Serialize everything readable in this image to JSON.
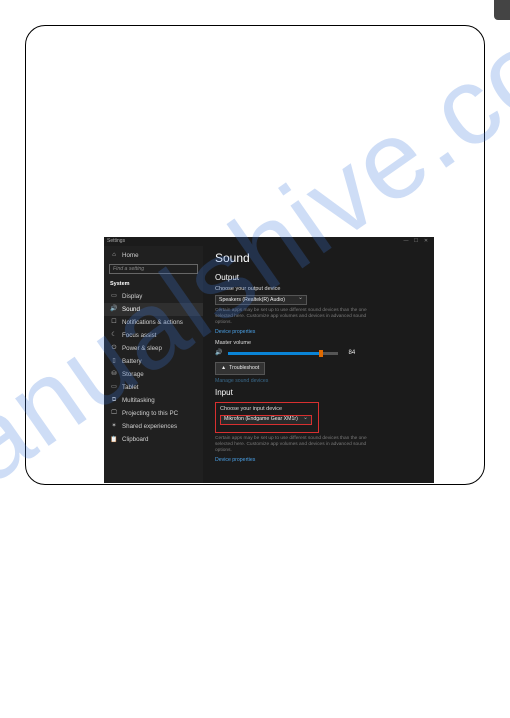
{
  "watermark": "manualshive.com",
  "window": {
    "title": "Settings",
    "controls": {
      "min": "—",
      "max": "☐",
      "close": "✕"
    }
  },
  "sidebar": {
    "home": "Home",
    "search_placeholder": "Find a setting",
    "section": "System",
    "items": [
      {
        "icon": "▭",
        "label": "Display"
      },
      {
        "icon": "🔊",
        "label": "Sound",
        "selected": true
      },
      {
        "icon": "☐",
        "label": "Notifications & actions"
      },
      {
        "icon": "☾",
        "label": "Focus assist"
      },
      {
        "icon": "⏻",
        "label": "Power & sleep"
      },
      {
        "icon": "▯",
        "label": "Battery"
      },
      {
        "icon": "⛁",
        "label": "Storage"
      },
      {
        "icon": "▭",
        "label": "Tablet"
      },
      {
        "icon": "⧉",
        "label": "Multitasking"
      },
      {
        "icon": "🖵",
        "label": "Projecting to this PC"
      },
      {
        "icon": "✶",
        "label": "Shared experiences"
      },
      {
        "icon": "📋",
        "label": "Clipboard"
      }
    ]
  },
  "page": {
    "title": "Sound",
    "output": {
      "heading": "Output",
      "choose_label": "Choose your output device",
      "device": "Speakers (Realtek(R) Audio)",
      "hint": "Certain apps may be set up to use different sound devices than the one selected here. Customize app volumes and devices in advanced sound options.",
      "device_props": "Device properties",
      "volume_label": "Master volume",
      "volume_value": "84",
      "troubleshoot": "Troubleshoot",
      "manage": "Manage sound devices"
    },
    "input": {
      "heading": "Input",
      "choose_label": "Choose your input device",
      "device": "Mikrofon (Endgame Gear XM1r)",
      "hint": "Certain apps may be set up to use different sound devices than the one selected here. Customize app volumes and devices in advanced sound options.",
      "device_props": "Device properties"
    }
  }
}
